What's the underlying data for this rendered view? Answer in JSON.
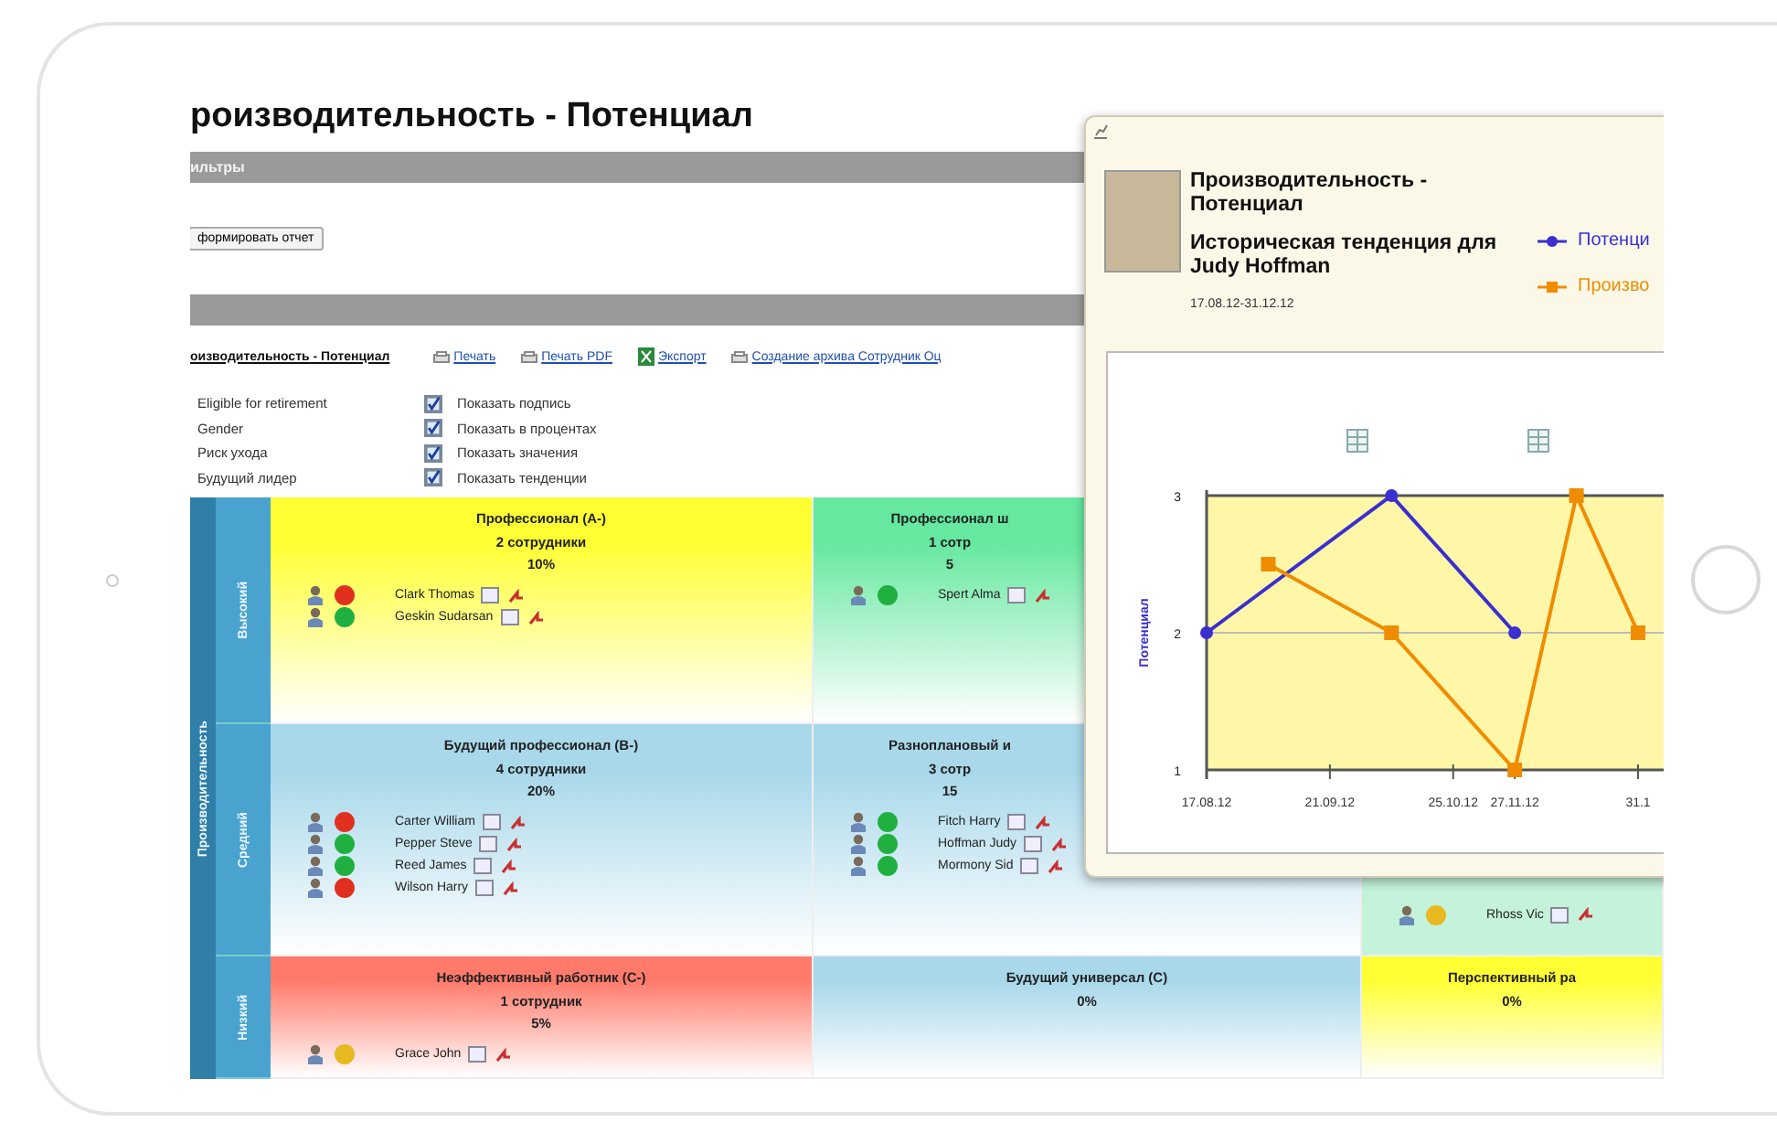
{
  "page": {
    "title": "роизводительность - Потенциал"
  },
  "filters_bar": {
    "label": "ильтры"
  },
  "generate_button": {
    "label": "формировать отчет"
  },
  "report_links": [
    {
      "label": "оизводительность - Потенциал",
      "kind": "title"
    },
    {
      "label": "Печать",
      "kind": "print"
    },
    {
      "label": "Печать PDF",
      "kind": "print"
    },
    {
      "label": "Экспорт",
      "kind": "excel"
    },
    {
      "label": "Создание архива Сотрудник Оц",
      "kind": "print"
    }
  ],
  "options": [
    "Eligible for retirement",
    "Gender",
    "Риск ухода",
    "Будущий лидер"
  ],
  "display_checkboxes": [
    {
      "label": "Показать подпись",
      "checked": true
    },
    {
      "label": "Показать в процентах",
      "checked": true
    },
    {
      "label": "Показать значения",
      "checked": true
    },
    {
      "label": "Показать тенденции",
      "checked": true
    }
  ],
  "grid": {
    "axis_label": "Производительность",
    "rows": [
      {
        "label": "Высокий",
        "cells": [
          {
            "title": "Профессионал (A-)",
            "count": "2 сотрудники",
            "percent": "10%",
            "color": "#ffff33",
            "people": [
              {
                "name": "Clark Thomas",
                "color": "#e03020"
              },
              {
                "name": "Geskin Sudarsan",
                "color": "#20b040"
              }
            ]
          },
          {
            "title": "Профессионал ш",
            "count": "1 сотр",
            "percent": "5",
            "color": "#66e8a0",
            "people": [
              {
                "name": "Spert Alma",
                "color": "#20b040"
              }
            ]
          },
          {}
        ]
      },
      {
        "label": "Средний",
        "cells": [
          {
            "title": "Будущий профессионал (B-)",
            "count": "4 сотрудники",
            "percent": "20%",
            "color": "#a8d8ea",
            "people": [
              {
                "name": "Carter William",
                "color": "#e03020"
              },
              {
                "name": "Pepper Steve",
                "color": "#20b040"
              },
              {
                "name": "Reed James",
                "color": "#20b040"
              },
              {
                "name": "Wilson Harry",
                "color": "#e03020"
              }
            ]
          },
          {
            "title": "Разноплановый и",
            "count": "3 сотр",
            "percent": "15",
            "color": "#a8d8ea",
            "people": [
              {
                "name": "Fitch Harry",
                "color": "#20b040"
              },
              {
                "name": "Hoffman Judy",
                "color": "#20b040"
              },
              {
                "name": "Mormony Sid",
                "color": "#20b040"
              }
            ]
          },
          {
            "color": "#c4f2da",
            "people": [
              {
                "name": "Rhoss Vic",
                "color": "#e8b820"
              }
            ]
          }
        ]
      },
      {
        "label": "Низкий",
        "cells": [
          {
            "title": "Неэффективный работник (C-)",
            "count": "1 сотрудник",
            "percent": "5%",
            "color": "#ff7a6a",
            "people": [
              {
                "name": "Grace John",
                "color": "#e8b820"
              }
            ]
          },
          {
            "title": "Будущий универсал (C)",
            "percent": "0%",
            "color": "#a8d8ea"
          },
          {
            "title": "Перспективный ра",
            "percent": "0%",
            "color": "#ffff33"
          }
        ]
      }
    ]
  },
  "popup": {
    "title": "Производительность - Потенциал",
    "subtitle": "Историческая тенденция для",
    "employee": "Judy Hoffman",
    "period": "17.08.12-31.12.12",
    "chart_data": {
      "type": "line",
      "ylabel": "Потенциал",
      "categories": [
        "17.08.12",
        null,
        "21.09.12",
        null,
        "25.10.12",
        "27.11.12",
        null,
        "31.1"
      ],
      "ylim": [
        1,
        3
      ],
      "yticks": [
        1,
        2,
        3
      ],
      "series": [
        {
          "name": "Потенци",
          "color": "#3a2fd0",
          "marker": "circle",
          "values": [
            2,
            null,
            null,
            3,
            null,
            2,
            null,
            null
          ]
        },
        {
          "name": "Произво",
          "color": "#f08c00",
          "marker": "square",
          "values": [
            null,
            2.5,
            null,
            2,
            null,
            1,
            3,
            2
          ]
        }
      ]
    }
  }
}
